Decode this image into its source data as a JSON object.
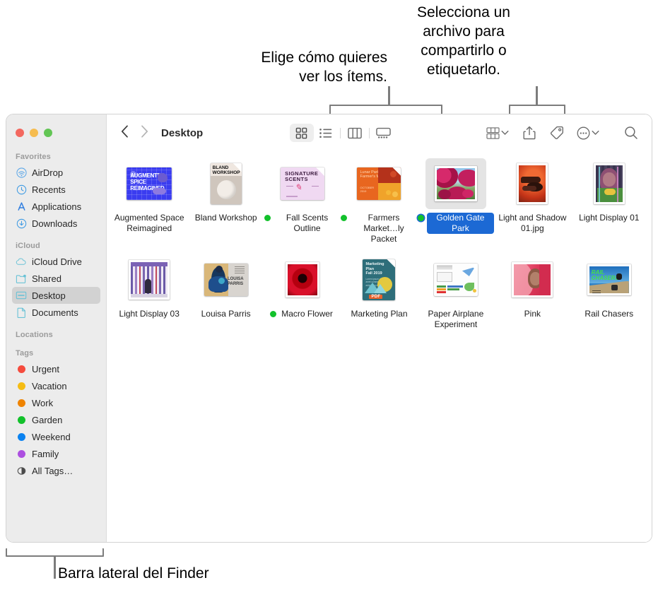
{
  "annotations": {
    "view_options": "Elige cómo quieres\nver los ítems.",
    "share_tag": "Selecciona un\narchivo para\ncompartirlo o\netiquetarlo.",
    "sidebar": "Barra lateral del Finder"
  },
  "window": {
    "traffic_lights": {
      "close": "close-button",
      "minimize": "minimize-button",
      "zoom": "zoom-button"
    }
  },
  "sidebar": {
    "sections": [
      {
        "header": "Favorites",
        "items": [
          {
            "label": "AirDrop",
            "icon": "airdrop-icon"
          },
          {
            "label": "Recents",
            "icon": "clock-icon"
          },
          {
            "label": "Applications",
            "icon": "applications-icon"
          },
          {
            "label": "Downloads",
            "icon": "download-icon"
          }
        ]
      },
      {
        "header": "iCloud",
        "items": [
          {
            "label": "iCloud Drive",
            "icon": "cloud-icon"
          },
          {
            "label": "Shared",
            "icon": "shared-folder-icon"
          },
          {
            "label": "Desktop",
            "icon": "desktop-icon",
            "selected": true
          },
          {
            "label": "Documents",
            "icon": "document-icon"
          }
        ]
      },
      {
        "header": "Locations",
        "items": []
      },
      {
        "header": "Tags",
        "items": [
          {
            "label": "Urgent",
            "icon": "tag-dot-icon",
            "color": "#f54b3d"
          },
          {
            "label": "Vacation",
            "icon": "tag-dot-icon",
            "color": "#f5bc14"
          },
          {
            "label": "Work",
            "icon": "tag-dot-icon",
            "color": "#ef8300"
          },
          {
            "label": "Garden",
            "icon": "tag-dot-icon",
            "color": "#12c12b"
          },
          {
            "label": "Weekend",
            "icon": "tag-dot-icon",
            "color": "#0b82f0"
          },
          {
            "label": "Family",
            "icon": "tag-dot-icon",
            "color": "#ac4fe0"
          },
          {
            "label": "All Tags…",
            "icon": "all-tags-icon"
          }
        ]
      }
    ]
  },
  "toolbar": {
    "back": "back-button",
    "forward": "forward-button",
    "title": "Desktop",
    "view_modes": [
      {
        "name": "icon-view",
        "label": "Icon view",
        "active": true
      },
      {
        "name": "list-view",
        "label": "List view",
        "active": false
      },
      {
        "name": "column-view",
        "label": "Column view",
        "active": false
      },
      {
        "name": "gallery-view",
        "label": "Gallery view",
        "active": false
      }
    ],
    "group_button": "Group items",
    "share_button": "Share",
    "tag_button": "Tags",
    "more_button": "More",
    "search_button": "Search"
  },
  "files": [
    {
      "name": "Augmented\nSpace Reimagined",
      "kind": "doc",
      "tag": null
    },
    {
      "name": "Bland Workshop",
      "kind": "doc",
      "tag": null
    },
    {
      "name": "Fall Scents\nOutline",
      "kind": "doc",
      "tag": "#12c12b"
    },
    {
      "name": "Farmers\nMarket…ly Packet",
      "kind": "doc",
      "tag": "#12c12b"
    },
    {
      "name": "Golden Gate\nPark",
      "kind": "photo",
      "tag": "#12c12b",
      "selected": true
    },
    {
      "name": "Light and Shadow\n01.jpg",
      "kind": "photo",
      "tag": null
    },
    {
      "name": "Light Display 01",
      "kind": "photo",
      "tag": null
    },
    {
      "name": "Light Display 03",
      "kind": "photo",
      "tag": null
    },
    {
      "name": "Louisa Parris",
      "kind": "doc",
      "tag": null
    },
    {
      "name": "Macro Flower",
      "kind": "photo",
      "tag": "#12c12b"
    },
    {
      "name": "Marketing Plan",
      "kind": "doc",
      "tag": null
    },
    {
      "name": "Paper Airplane\nExperiment",
      "kind": "doc",
      "tag": null
    },
    {
      "name": "Pink",
      "kind": "photo",
      "tag": null
    },
    {
      "name": "Rail Chasers",
      "kind": "photo",
      "tag": null
    }
  ]
}
